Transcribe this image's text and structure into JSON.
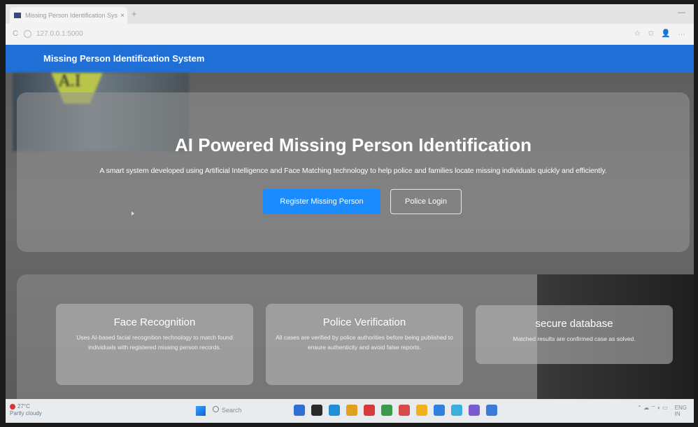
{
  "browser": {
    "tab_title": "Missing Person Identification Syst",
    "tab_close": "×",
    "new_tab": "+",
    "minimize": "—",
    "url": "127.0.0.1:5000",
    "reload_glyph": "C",
    "right_icons": [
      "☆",
      "✩",
      "👤",
      "…"
    ]
  },
  "navbar": {
    "brand": "Missing Person Identification System"
  },
  "photo": {
    "sign_text": "A.I"
  },
  "hero": {
    "title": "AI Powered Missing Person Identification",
    "subtitle": "A smart system developed using Artificial Intelligence and Face Matching technology to help police and families locate missing individuals quickly and efficiently.",
    "register_button": "Register Missing Person",
    "police_button": "Police Login"
  },
  "features": [
    {
      "title": "Face Recognition",
      "text": "Uses AI-based facial recognition technology to match found individuals with registered missing person records."
    },
    {
      "title": "Police Verification",
      "text": "All cases are verified by police authorities before being published to ensure authenticity and avoid false reports."
    },
    {
      "title": "secure database",
      "text": "Matched results are confirmed case as solved."
    }
  ],
  "taskbar": {
    "temp": "27°C",
    "weather": "Partly cloudy",
    "search": "Search",
    "lang_top": "ENG",
    "lang_bottom": "IN",
    "tray_icons": "⌃ ☁ ⌔ ◐ ▭",
    "app_colors": [
      "#2f6fd6",
      "#2a2a2a",
      "#1f8fd8",
      "#e0a020",
      "#d83a3a",
      "#3a9a4a",
      "#d84a4a",
      "#f0b020",
      "#2f80e0",
      "#3ab0e0",
      "#7a5ad0",
      "#3a7ad8"
    ]
  }
}
